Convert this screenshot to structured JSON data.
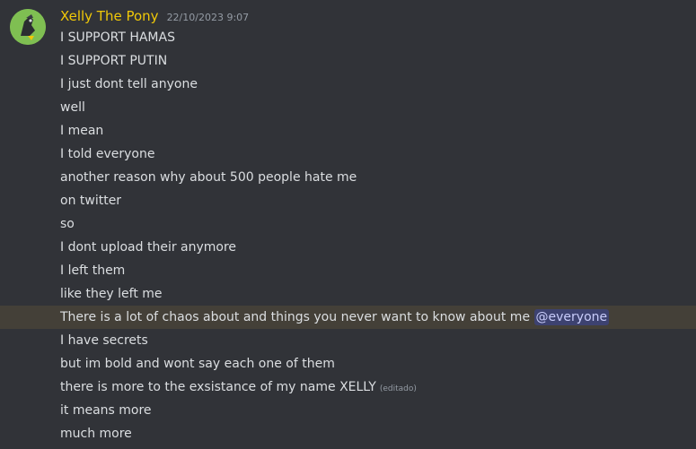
{
  "message": {
    "author": "Xelly The Pony",
    "timestamp": "22/10/2023 9:07",
    "avatar_icon": "pony-avatar-icon",
    "username_color": "#f0c808",
    "lines": [
      "I SUPPORT HAMAS",
      "I SUPPORT PUTIN",
      "I just dont tell anyone",
      "well",
      "I mean",
      "I told everyone",
      "another reason why about 500 people hate me",
      "on twitter",
      "so",
      "I dont upload their anymore",
      "I left them",
      "like they left me",
      "There is a lot of chaos about and things you never want to know about me",
      "I have secrets",
      "but im bold and wont say each one of them",
      "there is more to the exsistance of my name XELLY",
      "it means more",
      "much more"
    ],
    "mention": "@everyone",
    "edited_label": "(editado)"
  }
}
